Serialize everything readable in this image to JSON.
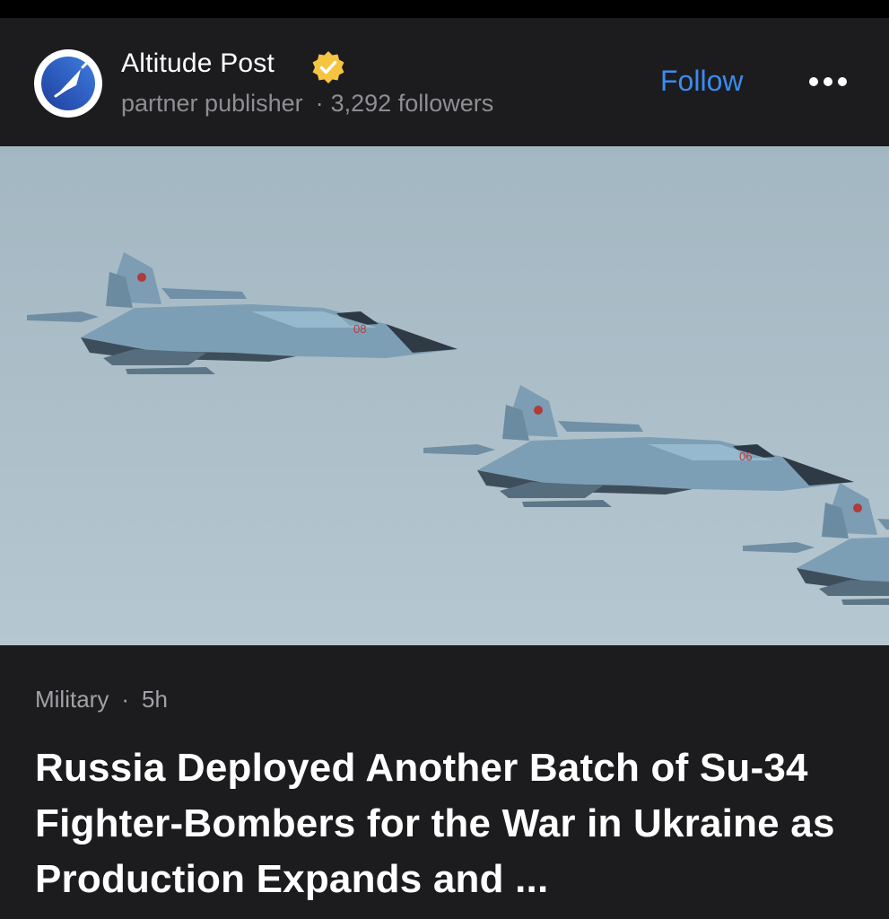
{
  "publisher": {
    "name": "Altitude Post",
    "type": "partner publisher",
    "followers": "3,292 followers",
    "separator": "·",
    "avatar_icon": "paper-plane-logo-icon",
    "badge_icon": "verified-badge-icon",
    "badge_color": "#f5c542"
  },
  "actions": {
    "follow_label": "Follow",
    "more_icon": "more-horizontal-icon",
    "accent_color": "#3b8bf0"
  },
  "hero_image": {
    "subject": "three Su-34 fighter-bombers in flight",
    "tail_numbers": [
      "08",
      "06"
    ]
  },
  "article": {
    "category": "Military",
    "separator": "·",
    "age": "5h",
    "headline": "Russia Deployed Another Batch of Su-34 Fighter-Bombers for the War in Ukraine as Production Expands and ..."
  }
}
